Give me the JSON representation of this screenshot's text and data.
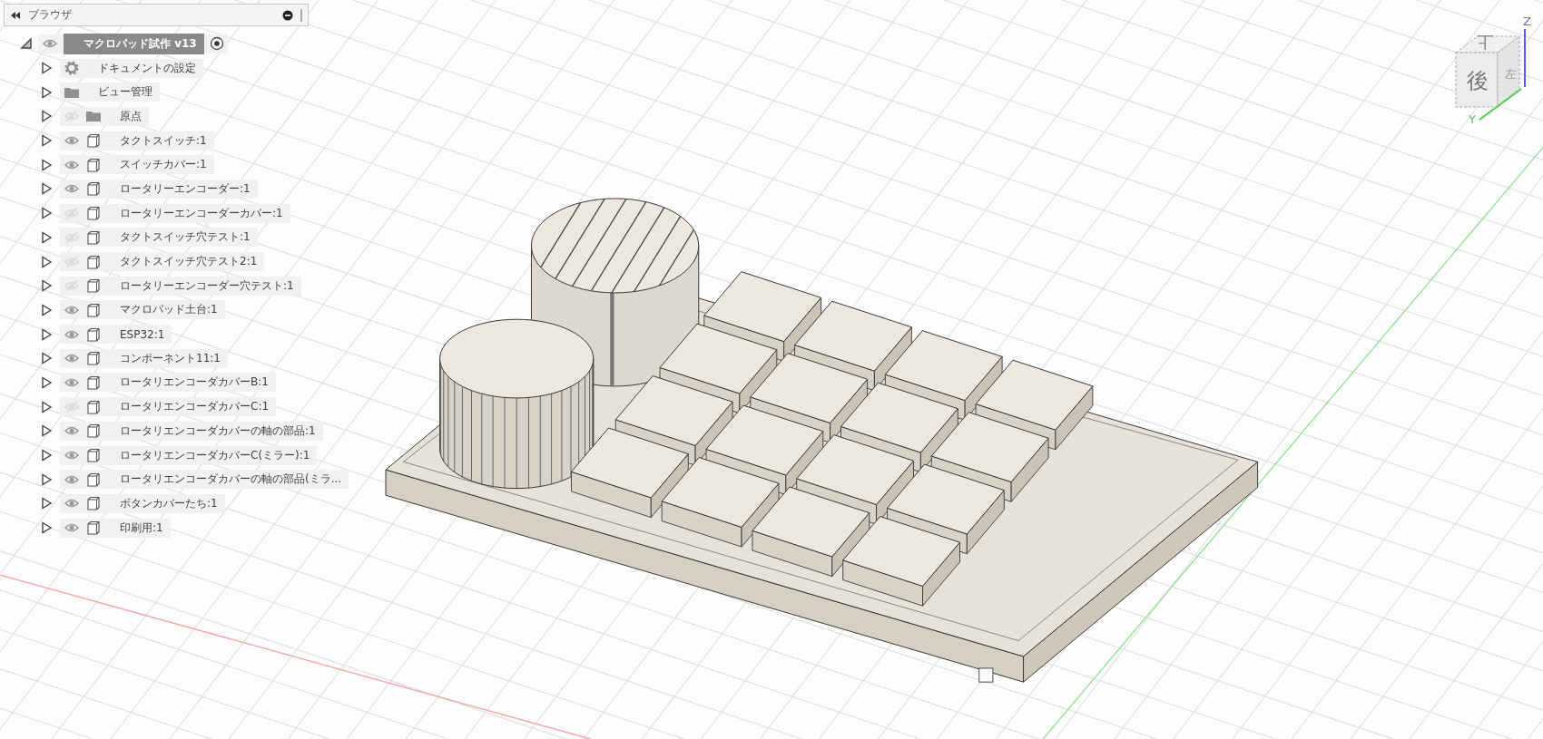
{
  "browser": {
    "title": "ブラウザ",
    "root": {
      "label": "マクロパッド試作 v13",
      "expanded": true,
      "visible": true,
      "active": true,
      "children": [
        {
          "kind": "settings",
          "label": "ドキュメントの設定",
          "expanded": false
        },
        {
          "kind": "folder",
          "label": "ビュー管理",
          "expanded": false
        },
        {
          "kind": "folder",
          "label": "原点",
          "visible": false,
          "expanded": false
        },
        {
          "kind": "component",
          "label": "タクトスイッチ:1",
          "visible": true,
          "expanded": false
        },
        {
          "kind": "component",
          "label": "スイッチカバー:1",
          "visible": true,
          "expanded": false
        },
        {
          "kind": "component",
          "label": "ロータリーエンコーダー:1",
          "visible": true,
          "expanded": false
        },
        {
          "kind": "component",
          "label": "ロータリーエンコーダーカバー:1",
          "visible": false,
          "expanded": false
        },
        {
          "kind": "component",
          "label": "タクトスイッチ穴テスト:1",
          "visible": false,
          "expanded": false
        },
        {
          "kind": "component",
          "label": "タクトスイッチ穴テスト2:1",
          "visible": false,
          "expanded": false
        },
        {
          "kind": "component",
          "label": "ロータリーエンコーダー穴テスト:1",
          "visible": false,
          "expanded": false
        },
        {
          "kind": "component",
          "label": "マクロパッド土台:1",
          "visible": true,
          "expanded": false
        },
        {
          "kind": "component",
          "label": "ESP32:1",
          "visible": true,
          "expanded": false
        },
        {
          "kind": "component",
          "label": "コンポーネント11:1",
          "visible": true,
          "expanded": false
        },
        {
          "kind": "component",
          "label": "ロータリエンコーダカバーB:1",
          "visible": true,
          "expanded": false
        },
        {
          "kind": "component",
          "label": "ロータリエンコーダカバーC:1",
          "visible": false,
          "expanded": false
        },
        {
          "kind": "component",
          "label": "ロータリエンコーダカバーの軸の部品:1",
          "visible": true,
          "expanded": false
        },
        {
          "kind": "component",
          "label": "ロータリエンコーダカバーC(ミラー):1",
          "visible": true,
          "expanded": false
        },
        {
          "kind": "component",
          "label": "ロータリエンコーダカバーの軸の部品(ミラ...",
          "visible": true,
          "expanded": false
        },
        {
          "kind": "component",
          "label": "ボタンカバーたち:1",
          "visible": true,
          "expanded": false
        },
        {
          "kind": "component",
          "label": "印刷用:1",
          "visible": true,
          "expanded": false
        }
      ]
    }
  },
  "view_cube": {
    "faces": [
      {
        "kind": "top",
        "label": "上"
      },
      {
        "kind": "front",
        "label": "後"
      },
      {
        "kind": "side",
        "label": "左"
      }
    ],
    "axes": [
      {
        "kind": "z",
        "label": "Z"
      },
      {
        "kind": "y",
        "label": "Y"
      }
    ]
  }
}
